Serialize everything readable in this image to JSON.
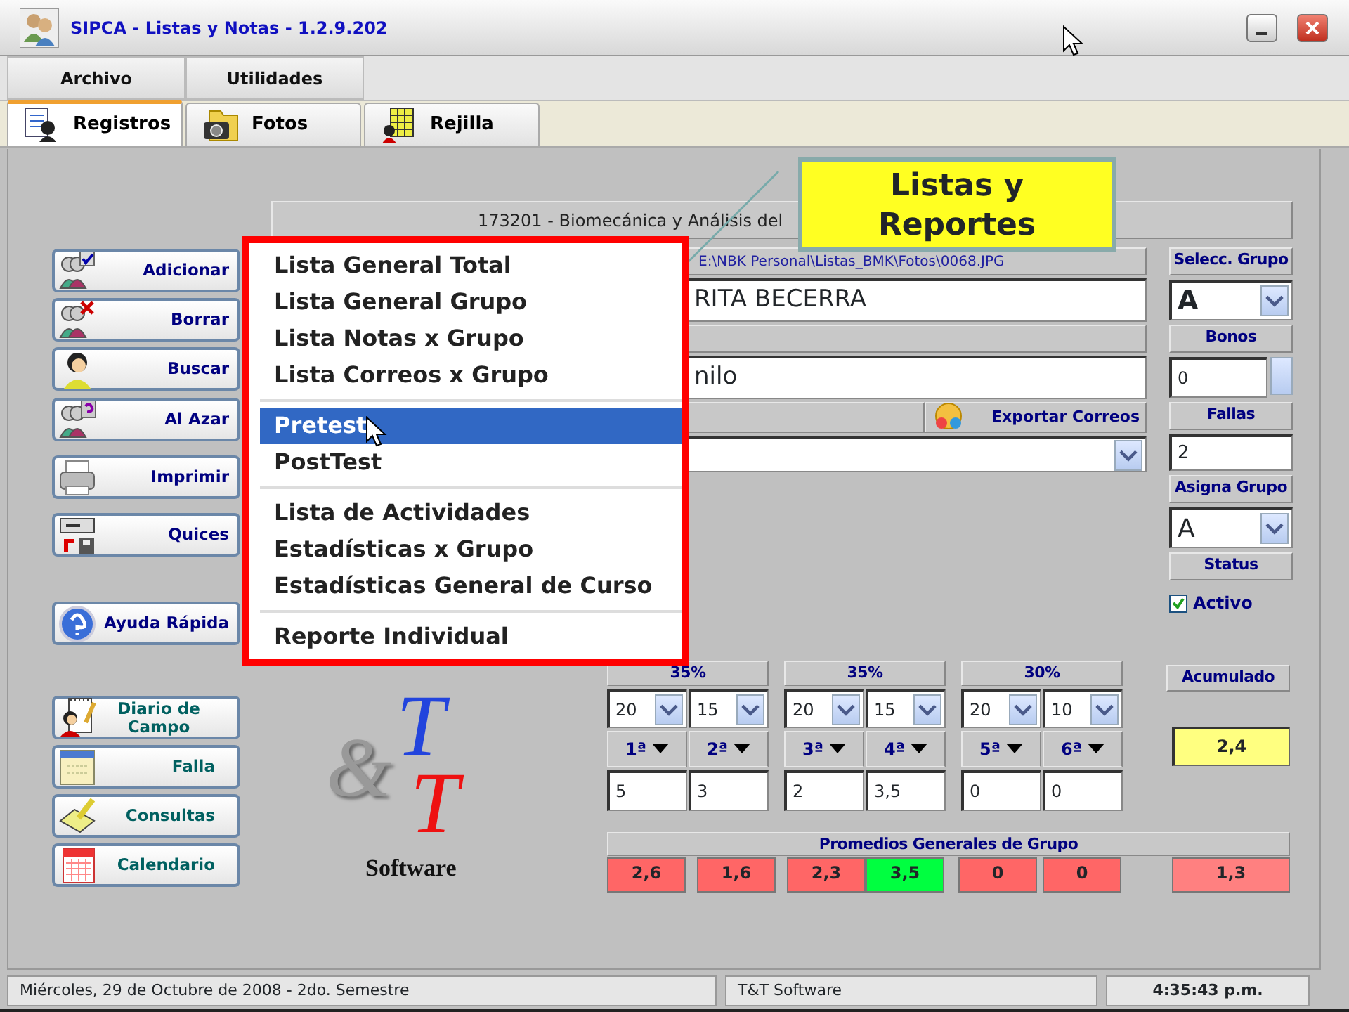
{
  "window": {
    "title": "SIPCA -  Listas y Notas  - 1.2.9.202"
  },
  "menu_bar": [
    "Archivo",
    "Utilidades"
  ],
  "tabs": [
    {
      "label": "Registros",
      "selected": true
    },
    {
      "label": "Fotos",
      "selected": false
    },
    {
      "label": "Rejilla",
      "selected": false
    }
  ],
  "left_buttons": [
    "Adicionar",
    "Borrar",
    "Buscar",
    "Al Azar",
    "Imprimir",
    "Quices",
    "Ayuda Rápida"
  ],
  "tool_buttons": [
    "Diario de Campo",
    "Falla",
    "Consultas",
    "Calendario"
  ],
  "course_title": "173201 - Biomecánica y Análisis del",
  "student": {
    "photo_path": "E:\\NBK Personal\\Listas_BMK\\Fotos\\0068.JPG",
    "name": "RITA BECERRA",
    "second_field": "nilo",
    "export_button": "Exportar Correos"
  },
  "side_panel": {
    "group_label": "Selecc. Grupo",
    "group_value": "A",
    "bonus_label": "Bonos",
    "bonus_value": "0",
    "absences_label": "Fallas",
    "absences_value": "2",
    "assign_label": "Asigna Grupo",
    "assign_value": "A",
    "status_label": "Status",
    "active": {
      "label": "Activo",
      "checked": true
    }
  },
  "grades": {
    "groups": [
      {
        "weight": "35%",
        "limits": [
          "20",
          "15"
        ],
        "notes": [
          {
            "label": "1ª",
            "value": "5"
          },
          {
            "label": "2ª",
            "value": "3"
          }
        ]
      },
      {
        "weight": "35%",
        "limits": [
          "20",
          "15"
        ],
        "notes": [
          {
            "label": "3ª",
            "value": "2"
          },
          {
            "label": "4ª",
            "value": "3,5"
          }
        ]
      },
      {
        "weight": "30%",
        "limits": [
          "20",
          "10"
        ],
        "notes": [
          {
            "label": "5ª",
            "value": "0"
          },
          {
            "label": "6ª",
            "value": "0"
          }
        ]
      }
    ],
    "accumulated_label": "Acumulado",
    "accumulated": "2,4",
    "averages_title": "Promedios Generales de Grupo",
    "averages": [
      {
        "value": "2,6",
        "color": "#ff6666"
      },
      {
        "value": "1,6",
        "color": "#ff6666"
      },
      {
        "value": "2,3",
        "color": "#ff6666"
      },
      {
        "value": "3,5",
        "color": "#00ff40"
      },
      {
        "value": "0",
        "color": "#ff6666"
      },
      {
        "value": "0",
        "color": "#ff6666"
      }
    ],
    "overall_average": {
      "value": "1,3",
      "color": "#ff8080"
    }
  },
  "logo": {
    "ampersand": "&",
    "letters": [
      "T",
      "T"
    ],
    "caption": "Software"
  },
  "context_menu": {
    "sections": [
      [
        {
          "label": "Lista General Total",
          "selected": false
        },
        {
          "label": "Lista General Grupo",
          "selected": false
        },
        {
          "label": "Lista Notas x Grupo",
          "selected": false
        },
        {
          "label": "Lista Correos x Grupo",
          "selected": false
        }
      ],
      [
        {
          "label": "Pretest",
          "selected": true
        },
        {
          "label": "PostTest",
          "selected": false
        }
      ],
      [
        {
          "label": "Lista de Actividades",
          "selected": false
        },
        {
          "label": "Estadísticas x Grupo",
          "selected": false
        },
        {
          "label": "Estadísticas General de Curso",
          "selected": false
        }
      ],
      [
        {
          "label": "Reporte Individual",
          "selected": false
        }
      ]
    ]
  },
  "callout": {
    "text": "Listas y Reportes"
  },
  "status_bar": [
    "Miércoles, 29 de Octubre de 2008 - 2do. Semestre",
    "T&T Software",
    "4:35:43 p.m."
  ]
}
